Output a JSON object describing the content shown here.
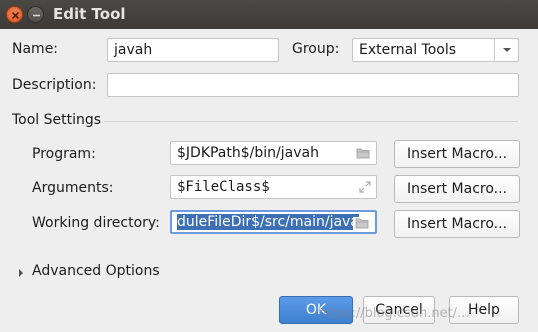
{
  "window": {
    "title": "Edit Tool",
    "buttons": {
      "close_icon": "close-icon",
      "minimize_icon": "minimize-icon"
    }
  },
  "form": {
    "name": {
      "label": "Name:",
      "value": "javah"
    },
    "group": {
      "label": "Group:",
      "value": "External Tools"
    },
    "description": {
      "label": "Description:",
      "value": ""
    }
  },
  "tool_settings": {
    "title": "Tool Settings",
    "program": {
      "label": "Program:",
      "value": "$JDKPath$/bin/javah",
      "button": "Insert Macro..."
    },
    "arguments": {
      "label": "Arguments:",
      "value": "$FileClass$",
      "button": "Insert Macro..."
    },
    "working_directory": {
      "label": "Working directory:",
      "value": "duleFileDir$/src/main/java",
      "button": "Insert Macro..."
    }
  },
  "advanced": {
    "label": "Advanced Options"
  },
  "footer": {
    "ok": "OK",
    "cancel": "Cancel",
    "help": "Help"
  },
  "watermark": "https://blog.csdn.net/...",
  "colors": {
    "accent": "#4a8ad9",
    "selection": "#3d6fb5",
    "titlebar": "#3f3e3a"
  }
}
